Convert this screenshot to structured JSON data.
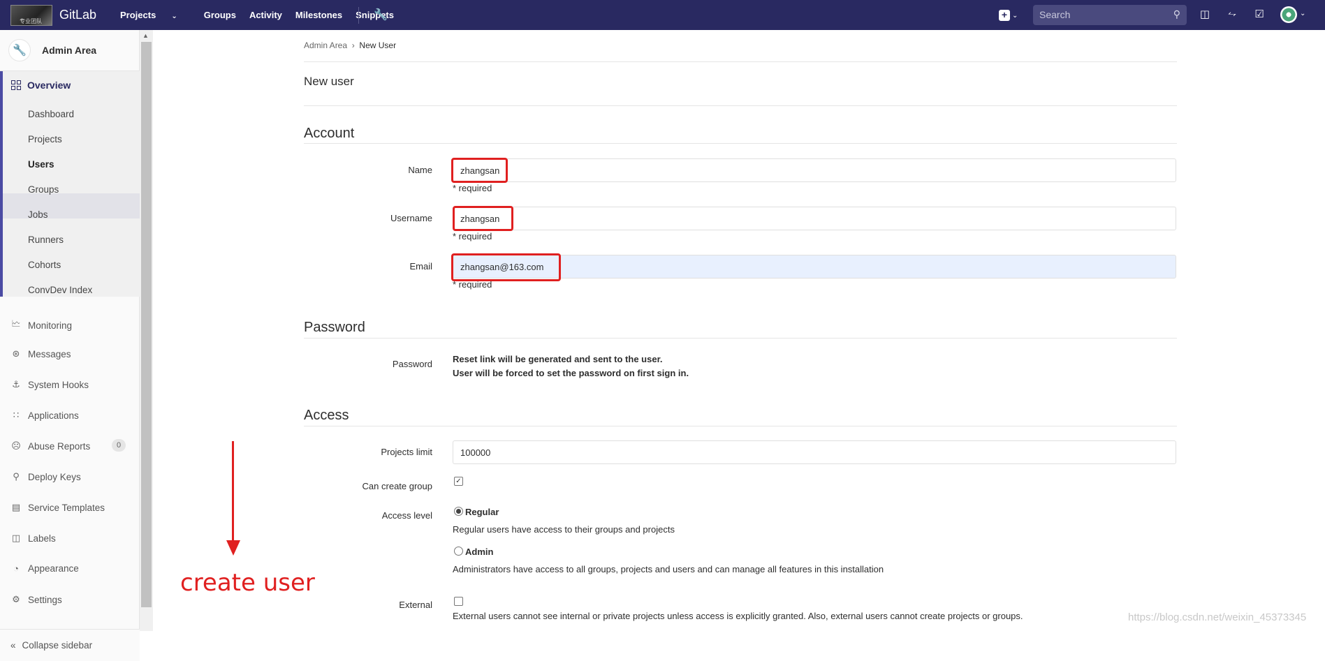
{
  "navbar": {
    "logo_text": "专业团队",
    "brand": "GitLab",
    "links": [
      "Projects",
      "Groups",
      "Activity",
      "Milestones",
      "Snippets"
    ],
    "search_placeholder": "Search"
  },
  "sidebar": {
    "header": "Admin Area",
    "overview": {
      "label": "Overview",
      "items": [
        "Dashboard",
        "Projects",
        "Users",
        "Groups",
        "Jobs",
        "Runners",
        "Cohorts",
        "ConvDev Index"
      ],
      "active": "Users"
    },
    "items": [
      {
        "label": "Monitoring",
        "icon": "monitor-icon"
      },
      {
        "label": "Messages",
        "icon": "broadcast-icon"
      },
      {
        "label": "System Hooks",
        "icon": "anchor-icon"
      },
      {
        "label": "Applications",
        "icon": "apps-grid-icon"
      },
      {
        "label": "Abuse Reports",
        "icon": "emoji-icon",
        "badge": "0"
      },
      {
        "label": "Deploy Keys",
        "icon": "key-icon"
      },
      {
        "label": "Service Templates",
        "icon": "template-icon"
      },
      {
        "label": "Labels",
        "icon": "label-icon"
      },
      {
        "label": "Appearance",
        "icon": "palette-icon"
      },
      {
        "label": "Settings",
        "icon": "gear-icon"
      }
    ],
    "collapse": "Collapse sidebar"
  },
  "breadcrumb": {
    "root": "Admin Area",
    "current": "New User"
  },
  "page_title": "New user",
  "account": {
    "title": "Account",
    "name_label": "Name",
    "name_value": "zhangsan",
    "username_label": "Username",
    "username_value": "zhangsan",
    "email_label": "Email",
    "email_value": "zhangsan@163.com",
    "required": "* required"
  },
  "password": {
    "title": "Password",
    "label": "Password",
    "line1": "Reset link will be generated and sent to the user.",
    "line2": "User will be forced to set the password on first sign in."
  },
  "access": {
    "title": "Access",
    "projects_limit_label": "Projects limit",
    "projects_limit_value": "100000",
    "can_create_group_label": "Can create group",
    "can_create_group_checked": true,
    "access_level_label": "Access level",
    "regular_label": "Regular",
    "regular_help": "Regular users have access to their groups and projects",
    "admin_label": "Admin",
    "admin_help": "Administrators have access to all groups, projects and users and can manage all features in this installation",
    "selected": "Regular",
    "external_label": "External",
    "external_help": "External users cannot see internal or private projects unless access is explicitly granted. Also, external users cannot create projects or groups.",
    "external_checked": false
  },
  "annotation": {
    "text": "create user",
    "color": "#e02020"
  },
  "watermark": "https://blog.csdn.net/weixin_45373345",
  "colors": {
    "navbar": "#292961",
    "accent": "#4b4ba3",
    "highlight": "#e02020"
  }
}
